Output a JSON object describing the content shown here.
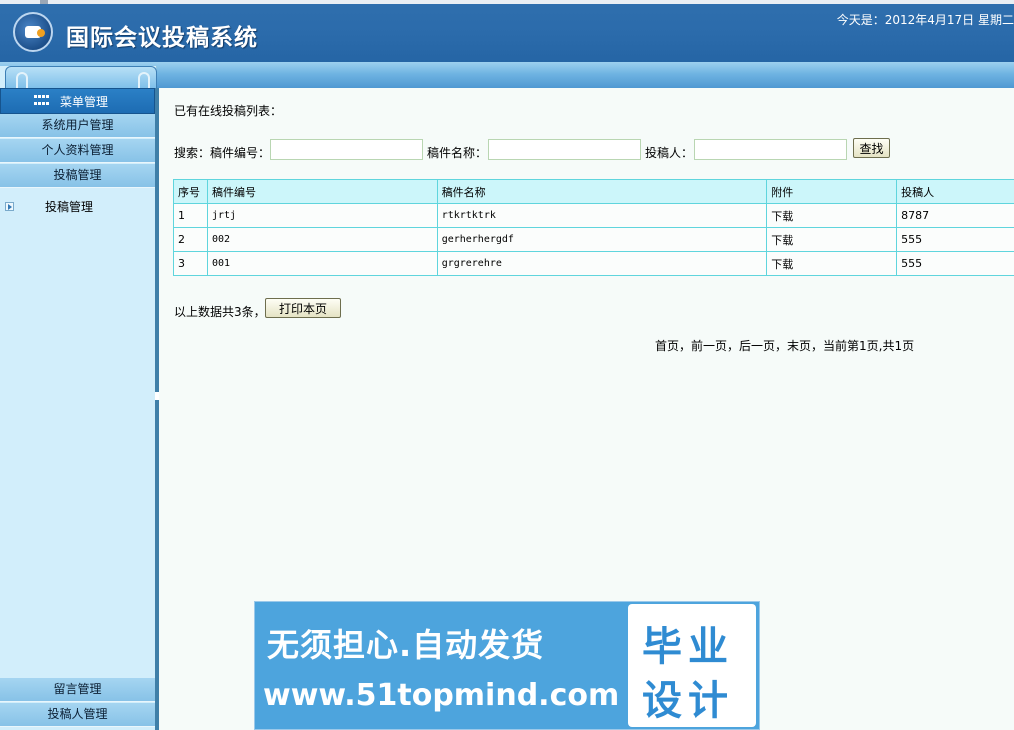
{
  "header": {
    "title": "国际会议投稿系统",
    "date_text": "今天是：2012年4月17日  星期二"
  },
  "sidebar": {
    "menu_title": "菜单管理",
    "items": [
      {
        "label": "系统用户管理"
      },
      {
        "label": "个人资料管理"
      },
      {
        "label": "投稿管理"
      }
    ],
    "active_sub": {
      "label": "投稿管理"
    },
    "bottom_items": [
      {
        "label": "留言管理"
      },
      {
        "label": "投稿人管理"
      }
    ]
  },
  "main": {
    "list_title": "已有在线投稿列表：",
    "search": {
      "prefix": "搜索：",
      "code_label": "稿件编号：",
      "code_value": "",
      "name_label": "稿件名称：",
      "name_value": "",
      "author_label": "投稿人：",
      "author_value": "",
      "button": "查找"
    },
    "table": {
      "columns": [
        "序号",
        "稿件编号",
        "稿件名称",
        "附件",
        "投稿人"
      ],
      "rows": [
        {
          "no": "1",
          "code": "jrtj",
          "name": "rtkrtktrk",
          "attach": "下载",
          "author": "8787"
        },
        {
          "no": "2",
          "code": "002",
          "name": "gerherhergdf",
          "attach": "下载",
          "author": "555"
        },
        {
          "no": "3",
          "code": "001",
          "name": "grgrerehre",
          "attach": "下载",
          "author": "555"
        }
      ]
    },
    "total_text": "以上数据共3条，",
    "print_button": "打印本页",
    "pagination": "首页，前一页，后一页，末页，当前第1页,共1页"
  },
  "banner": {
    "slogan": "无须担心.自动发货",
    "url": "www.51topmind.com",
    "tag_line1": "毕业",
    "tag_line2": "设计"
  }
}
